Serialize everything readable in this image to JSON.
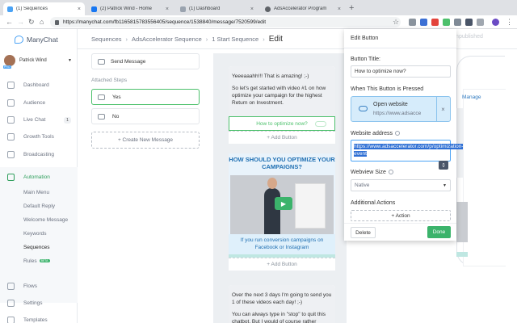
{
  "browser": {
    "tabs": [
      {
        "label": "(1) Sequences",
        "color": "#4ba3f5",
        "active": true
      },
      {
        "label": "(2) Patrick Wind - Home",
        "color": "#1877f2",
        "active": false
      },
      {
        "label": "(1) Dashboard",
        "color": "#9aa3af",
        "active": false
      },
      {
        "label": "AdsAccelerator Program",
        "color": "#5f6368",
        "active": false
      }
    ],
    "new_tab": "+",
    "url": "https://manychat.com/fb1165815783556405/sequence/1538840/message/7520599/edit"
  },
  "sidebar": {
    "brand": "ManyChat",
    "profile_name": "Patrick Wind",
    "pro_badge": "PRO",
    "items_top": [
      {
        "label": "Dashboard",
        "icon": "home-icon"
      },
      {
        "label": "Audience",
        "icon": "people-icon"
      },
      {
        "label": "Live Chat",
        "icon": "chat-icon",
        "badge": "1"
      },
      {
        "label": "Growth Tools",
        "icon": "growth-icon"
      },
      {
        "label": "Broadcasting",
        "icon": "broadcast-icon"
      },
      {
        "label": "Automation",
        "icon": "automation-icon"
      }
    ],
    "sub_items": [
      "Main Menu",
      "Default Reply",
      "Welcome Message",
      "Keywords",
      "Sequences",
      "Rules"
    ],
    "rules_badge": "BETA",
    "items_bottom": [
      {
        "label": "Flows",
        "icon": "flows-icon"
      },
      {
        "label": "Settings",
        "icon": "settings-icon"
      },
      {
        "label": "Templates",
        "icon": "templates-icon"
      }
    ]
  },
  "header": {
    "crumbs": [
      "Sequences",
      "AdsAccelerator Sequence",
      "1 Start Sequence"
    ],
    "current": "Edit",
    "publish_label": "Unpublished"
  },
  "steps": {
    "send_message": "Send Message",
    "attached_label": "Attached Steps",
    "buttons": [
      "Yes",
      "No"
    ],
    "create_new": "+ Create New Message"
  },
  "canvas": {
    "msg1_lines": [
      "Yeeeaaahh!!! That is amazing! ;-)",
      "So let's get started with video #1 on how optimize your campaign for the highest Return on Investment."
    ],
    "msg1_button": "How to optimize now?",
    "add_button": "+ Add Button",
    "video_heading": "HOW SHOULD YOU OPTIMIZE YOUR CAMPAIGNS?",
    "video_caption": "If you run conversion campaigns on Facebook or Instagram",
    "add_button2": "+ Add Button",
    "msg2_lines": [
      "Over the next 3 days I'm going to send you 1 of these videos each day! ;-)",
      "You can always type in \"stop\" to quit this chatbot. But I would of course rather"
    ]
  },
  "edit_button": {
    "panel_title": "Edit Button",
    "title_label": "Button Title:",
    "title_value": "How to optimize now?",
    "when_label": "When This Button is Pressed",
    "action_title": "Open website",
    "action_sub": "https://www.adsacce",
    "website_label": "Website address",
    "website_value": "https://www.adsaccelerator.com/p/optimization-event",
    "webview_label": "Webview Size",
    "webview_value": "Native",
    "additional_label": "Additional Actions",
    "add_action": "+ Action",
    "delete_label": "Delete",
    "done_label": "Done"
  },
  "preview": {
    "manage_label": "Manage"
  },
  "colors": {
    "accent_green": "#3bb36b",
    "brand_blue": "#4ba3f5",
    "selection_blue": "#2e6fd4"
  }
}
